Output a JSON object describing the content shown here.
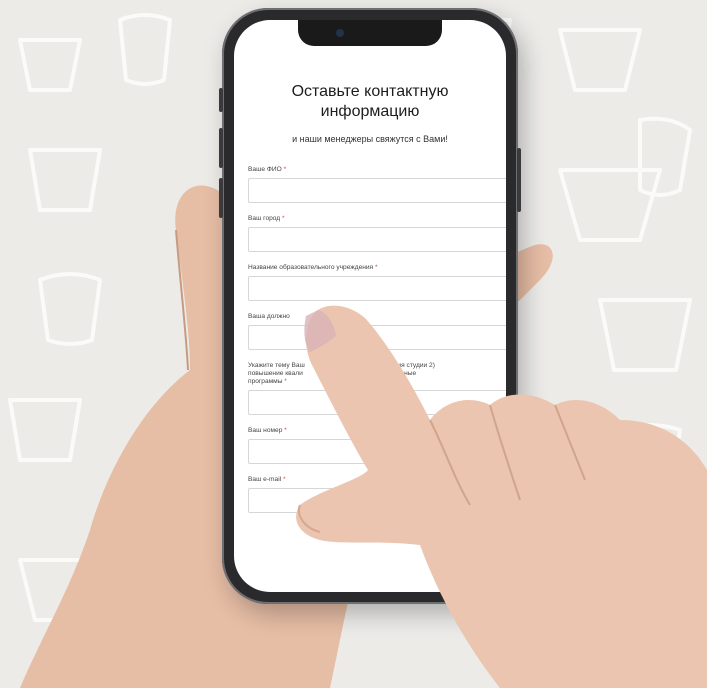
{
  "form": {
    "title_line1": "Оставьте контактную",
    "title_line2": "информацию",
    "subtitle": "и наши менеджеры свяжутся с Вами!",
    "required_mark": "*",
    "fields": [
      {
        "label": "Ваше ФИО",
        "value": ""
      },
      {
        "label": "Ваш город",
        "value": ""
      },
      {
        "label": "Название образовательного учреждения",
        "value": ""
      },
      {
        "label": "Ваша должно",
        "value": ""
      },
      {
        "label": "Укажите тему Ваш",
        "label_cont": "1) организация студии 2)",
        "label_line2": "повышение квали",
        "label_line2_cont": "е образовательные",
        "label_line3": "программы",
        "value": ""
      },
      {
        "label": "Ваш номер",
        "value": ""
      },
      {
        "label": "Ваш e-mail",
        "value": ""
      }
    ]
  },
  "colors": {
    "background": "#ecebe8",
    "phone_frame": "#2a2a2c",
    "screen": "#ffffff",
    "required": "#d04a2a",
    "skin": "#e9c2ab"
  }
}
